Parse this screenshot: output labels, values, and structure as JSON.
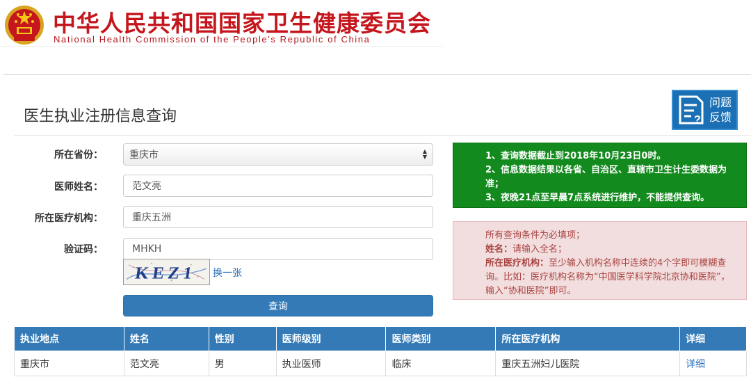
{
  "banner": {
    "title_cn": "中华人民共和国国家卫生健康委员会",
    "title_en": "National Health Commission of the People's Republic of China",
    "brand_red": "#c4161c"
  },
  "page": {
    "title": "医生执业注册信息查询",
    "feedback_label_line1": "问题",
    "feedback_label_line2": "反馈"
  },
  "form": {
    "province_label": "所在省份：",
    "province_value": "重庆市",
    "name_label": "医师姓名：",
    "name_value": "范文亮",
    "institution_label": "所在医疗机构：",
    "institution_value": "重庆五洲",
    "captcha_label": "验证码：",
    "captcha_value": "MHKH",
    "captcha_image_text": "KEZ1",
    "captcha_refresh": "换一张",
    "submit_label": "查询"
  },
  "notices": {
    "green": [
      "1、查询数据截止到2018年10月23日0时。",
      "2、信息数据结果以各省、自治区、直辖市卫生计生委数据为准；",
      "3、夜晚21点至早晨7点系统进行维护，不能提供查询。"
    ],
    "red_line1": "所有查询条件为必填项；",
    "red_name_key": "姓名：",
    "red_name_text": "请输入全名；",
    "red_inst_key": "所在医疗机构：",
    "red_inst_text": "至少输入机构名称中连续的4个字即可模糊查询。比如：医疗机构名称为“中国医学科学院北京协和医院”，输入“协和医院”即可。"
  },
  "table": {
    "headers": [
      "执业地点",
      "姓名",
      "性别",
      "医师级别",
      "医师类别",
      "所在医疗机构",
      "详细"
    ],
    "rows": [
      [
        "重庆市",
        "范文亮",
        "男",
        "执业医师",
        "临床",
        "重庆五洲妇儿医院",
        "详细"
      ]
    ]
  }
}
